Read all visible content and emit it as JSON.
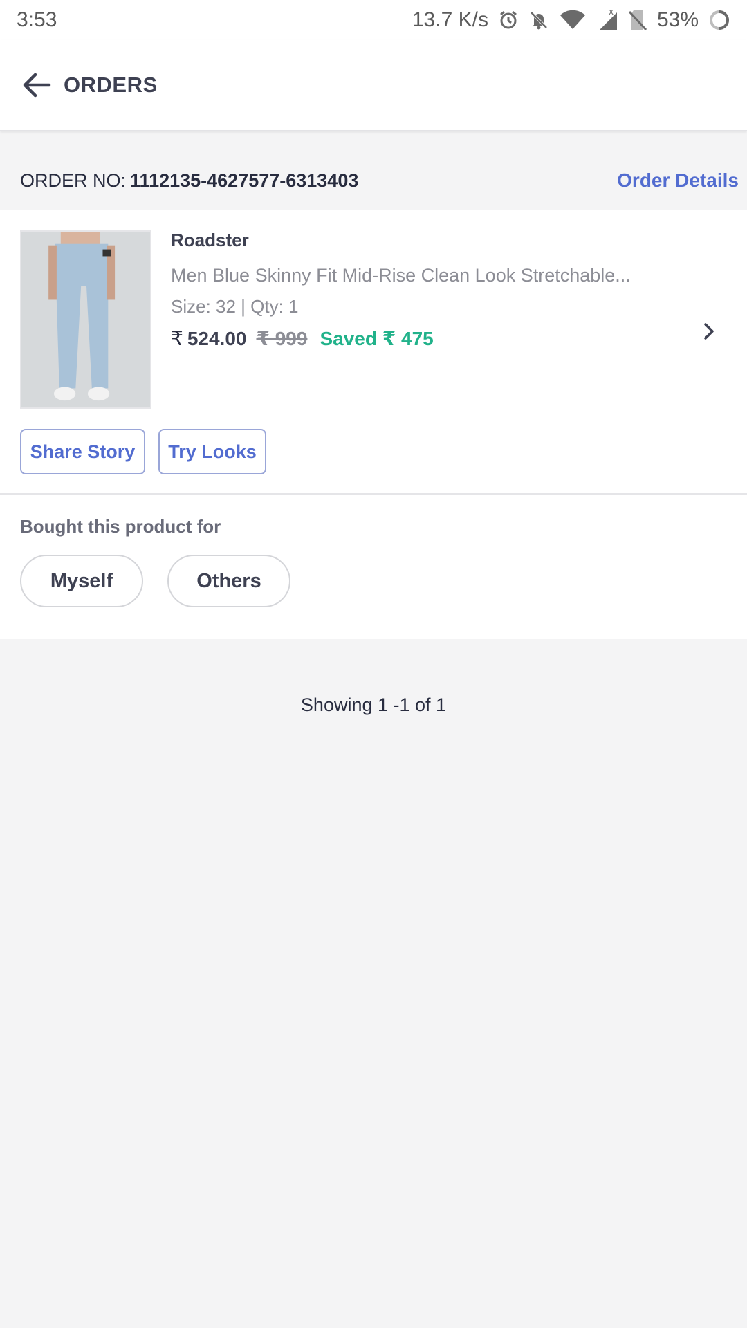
{
  "status_bar": {
    "time": "3:53",
    "net_speed": "13.7 K/s",
    "battery": "53%",
    "icons": [
      "alarm-icon",
      "bell-off-icon",
      "wifi-icon",
      "cell-signal-icon",
      "no-sim-icon",
      "battery-icon"
    ]
  },
  "header": {
    "title": "ORDERS",
    "back_icon": "arrow-left-icon"
  },
  "order": {
    "label": "ORDER NO:",
    "number": "1112135-4627577-6313403",
    "details_link": "Order Details"
  },
  "item": {
    "brand": "Roadster",
    "name": "Men Blue Skinny Fit Mid-Rise Clean Look Stretchable...",
    "size_qty": "Size: 32 | Qty: 1",
    "currency": "₹",
    "price": "524.00",
    "mrp": "₹ 999",
    "saved": "Saved ₹ 475"
  },
  "actions": {
    "share_story": "Share Story",
    "try_looks": "Try Looks"
  },
  "bought_for": {
    "label": "Bought this product for",
    "options": [
      "Myself",
      "Others"
    ]
  },
  "pagination": {
    "text": "Showing 1 -1 of 1"
  },
  "colors": {
    "accent": "#526cd0",
    "saved": "#21b28a",
    "background": "#f4f4f5"
  }
}
